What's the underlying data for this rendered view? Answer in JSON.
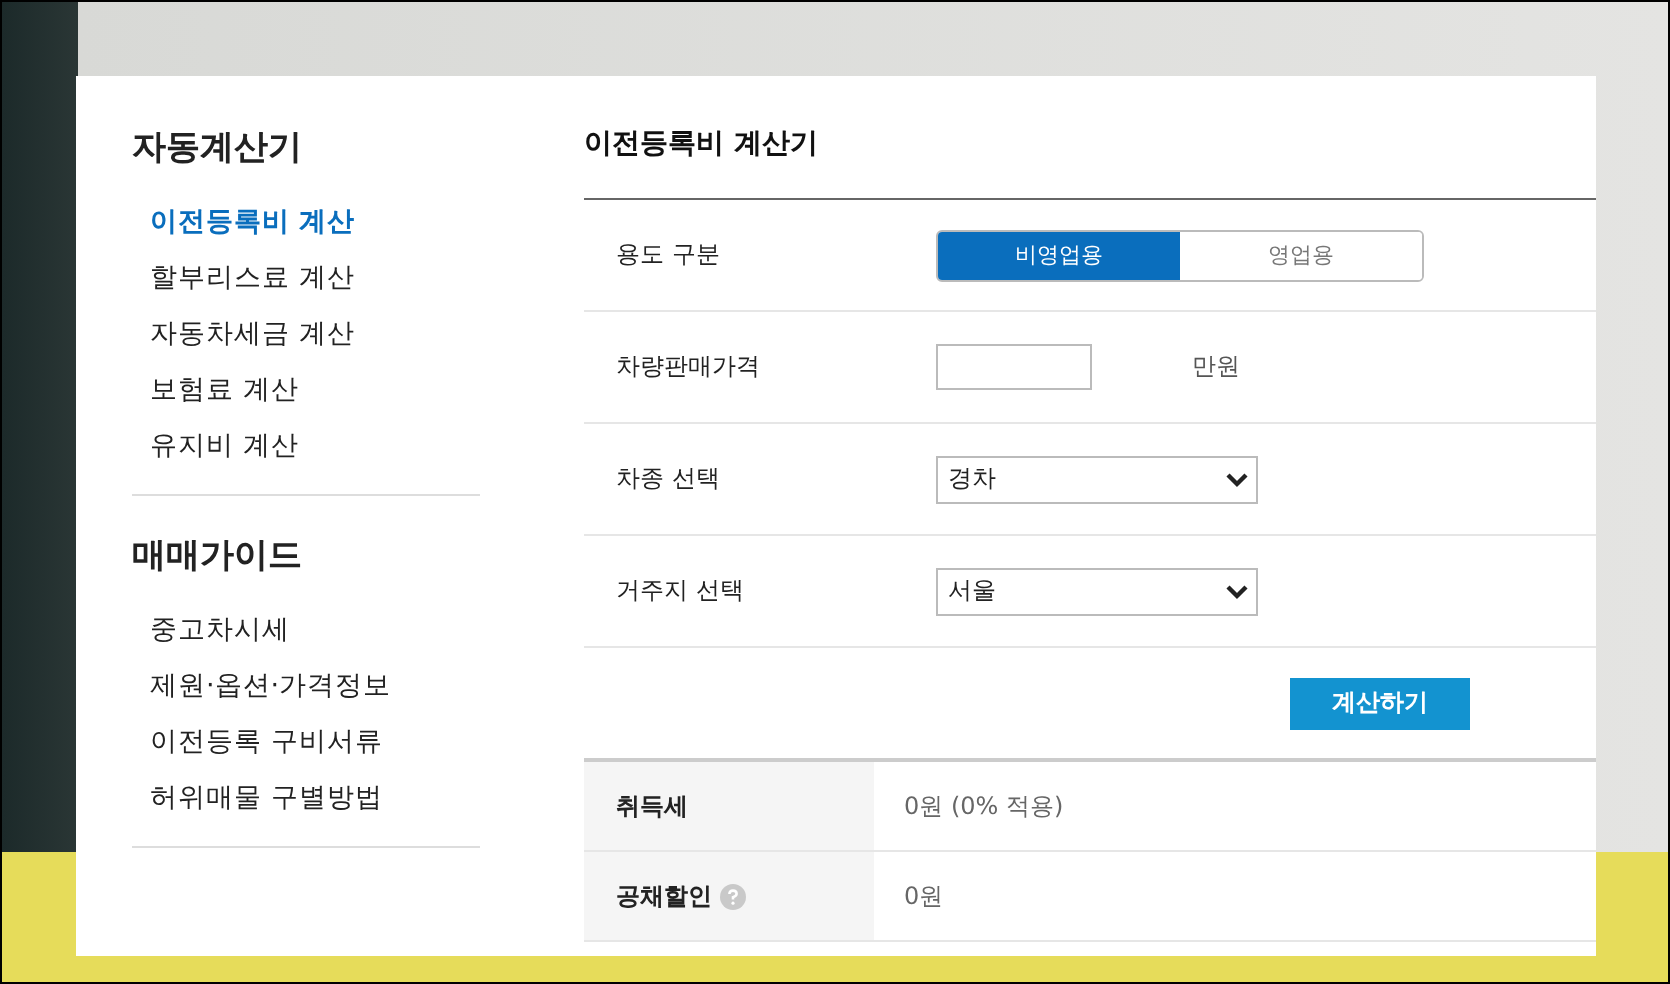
{
  "sidebar": {
    "sections": [
      {
        "title": "자동계산기",
        "items": [
          {
            "label": "이전등록비 계산",
            "selected": true
          },
          {
            "label": "할부리스료 계산",
            "selected": false
          },
          {
            "label": "자동차세금 계산",
            "selected": false
          },
          {
            "label": "보험료 계산",
            "selected": false
          },
          {
            "label": "유지비 계산",
            "selected": false
          }
        ]
      },
      {
        "title": "매매가이드",
        "items": [
          {
            "label": "중고차시세",
            "selected": false
          },
          {
            "label": "제원·옵션·가격정보",
            "selected": false
          },
          {
            "label": "이전등록 구비서류",
            "selected": false
          },
          {
            "label": "허위매물 구별방법",
            "selected": false
          }
        ]
      }
    ]
  },
  "calculator": {
    "title": "이전등록비 계산기",
    "fields": [
      {
        "kind": "toggle",
        "label": "용도 구분",
        "options": [
          {
            "label": "비영업용",
            "selected": true
          },
          {
            "label": "영업용",
            "selected": false
          }
        ]
      },
      {
        "kind": "input",
        "label": "차량판매가격",
        "unit": "만원"
      },
      {
        "kind": "select",
        "label": "차종 선택",
        "value": "경차"
      },
      {
        "kind": "select",
        "label": "거주지 선택",
        "value": "서울"
      }
    ],
    "button": "계산하기",
    "results": [
      {
        "label": "취득세",
        "value": "0원 (0% 적용)",
        "info": false
      },
      {
        "label": "공채할인",
        "value": "0원",
        "info": true
      }
    ]
  }
}
